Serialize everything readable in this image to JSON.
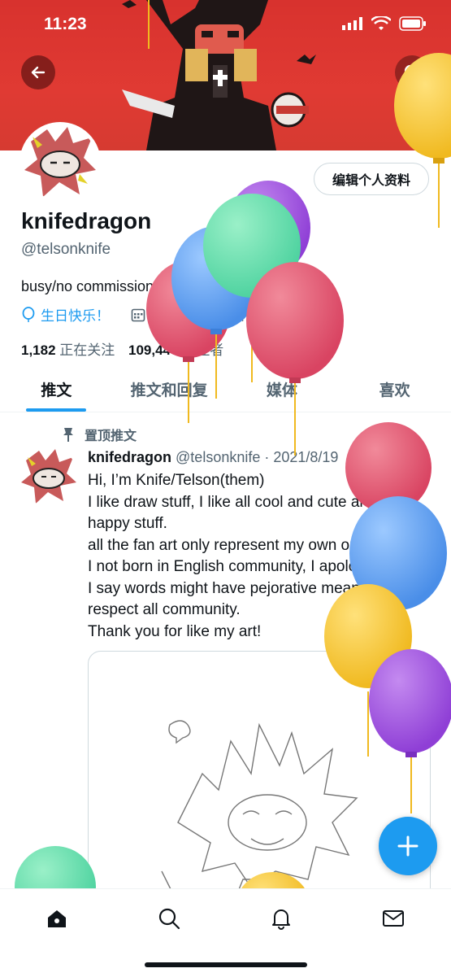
{
  "status_bar": {
    "time": "11:23"
  },
  "profile": {
    "display_name": "knifedragon",
    "handle": "@telsonknife",
    "bio": "busy/no commission/",
    "birthday": "生日快乐！",
    "joined": "2015年6月加入",
    "following_count": "1,182",
    "following_label": "正在关注",
    "followers_count": "109,440",
    "followers_label": "关注者",
    "edit_button_label": "编辑个人资料"
  },
  "tabs": [
    {
      "label": "推文"
    },
    {
      "label": "推文和回复"
    },
    {
      "label": "媒体"
    },
    {
      "label": "喜欢"
    }
  ],
  "tweet": {
    "pinned_label": "置顶推文",
    "author": "knifedragon",
    "handle": "@telsonknife",
    "date": "· 2021/8/19",
    "more": "···",
    "text": "Hi, I’m Knife/Telson(them)\nI like draw stuff, I like all cool and cute art\nhappy stuff.\nall the fan art only represent my own opinion.\nI not born in English community, I apologize if\nI say words might have pejorative meaning. I\nrespect all community.\nThank you for like my art!"
  },
  "fab": {
    "icon": "plus-icon"
  },
  "bottom_nav": [
    {
      "icon": "home-icon"
    },
    {
      "icon": "search-icon"
    },
    {
      "icon": "bell-icon"
    },
    {
      "icon": "mail-icon"
    }
  ],
  "colors": {
    "accent": "#1d9bf0",
    "banner": "#e03a33"
  }
}
